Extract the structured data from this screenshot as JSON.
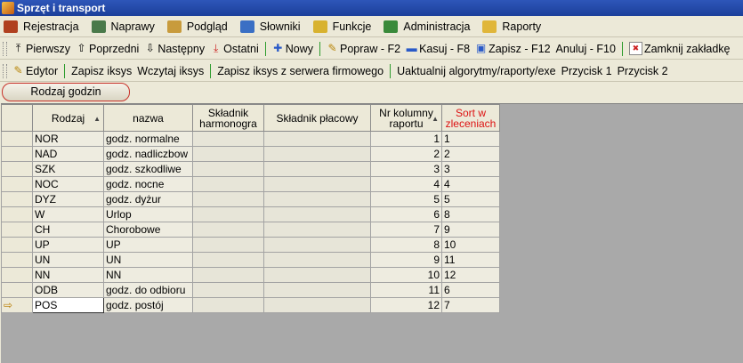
{
  "window": {
    "title": "Sprzęt i transport"
  },
  "menu": [
    {
      "label": "Rejestracja",
      "icon": "pen-icon",
      "color": "#b0401f"
    },
    {
      "label": "Naprawy",
      "icon": "wrench-icon",
      "color": "#4a7a4a"
    },
    {
      "label": "Podgląd",
      "icon": "clipboard-icon",
      "color": "#c89b3c"
    },
    {
      "label": "Słowniki",
      "icon": "book-icon",
      "color": "#3a6fc4"
    },
    {
      "label": "Funkcje",
      "icon": "gear-icon",
      "color": "#d8b22f"
    },
    {
      "label": "Administracja",
      "icon": "books-icon",
      "color": "#3a8a3a"
    },
    {
      "label": "Raporty",
      "icon": "report-icon",
      "color": "#e0b63a"
    }
  ],
  "toolbar1": [
    {
      "label": "Pierwszy",
      "icon": "⤒"
    },
    {
      "label": "Poprzedni",
      "icon": "⇧"
    },
    {
      "label": "Następny",
      "icon": "⇩"
    },
    {
      "label": "Ostatni",
      "icon": "⤓"
    },
    {
      "label": "Nowy",
      "icon": "✚"
    },
    {
      "label": "Popraw - F2",
      "icon": "✎"
    },
    {
      "label": "Kasuj - F8",
      "icon": "▬"
    },
    {
      "label": "Zapisz - F12",
      "icon": "▣"
    },
    {
      "label": "Anuluj - F10",
      "icon": ""
    },
    {
      "label": "Zamknij zakładkę",
      "icon": "✖"
    }
  ],
  "toolbar2": [
    {
      "label": "Edytor",
      "icon": "✎"
    },
    {
      "label": "Zapisz iksys"
    },
    {
      "label": "Wczytaj iksys"
    },
    {
      "label": "Zapisz iksys z serwera firmowego"
    },
    {
      "label": "Uaktualnij algorytmy/raporty/exe"
    },
    {
      "label": "Przycisk 1"
    },
    {
      "label": "Przycisk 2"
    }
  ],
  "tab_button": "Rodzaj godzin",
  "table": {
    "headers": [
      "Rodzaj",
      "nazwa",
      "Składnik harmonogra",
      "Składnik płacowy",
      "Nr kolumny raportu",
      "Sort w zleceniach"
    ],
    "rows": [
      {
        "kod": "NOR",
        "nazwa": "godz. normalne",
        "nr": "1",
        "sort": "1"
      },
      {
        "kod": "NAD",
        "nazwa": "godz. nadliczbow",
        "nr": "2",
        "sort": "2"
      },
      {
        "kod": "SZK",
        "nazwa": "godz. szkodliwe",
        "nr": "3",
        "sort": "3"
      },
      {
        "kod": "NOC",
        "nazwa": "godz. nocne",
        "nr": "4",
        "sort": "4"
      },
      {
        "kod": "DYZ",
        "nazwa": "godz. dyżur",
        "nr": "5",
        "sort": "5"
      },
      {
        "kod": "W",
        "nazwa": "Urlop",
        "nr": "6",
        "sort": "8"
      },
      {
        "kod": "CH",
        "nazwa": "Chorobowe",
        "nr": "7",
        "sort": "9"
      },
      {
        "kod": "UP",
        "nazwa": "UP",
        "nr": "8",
        "sort": "10"
      },
      {
        "kod": "UN",
        "nazwa": "UN",
        "nr": "9",
        "sort": "11"
      },
      {
        "kod": "NN",
        "nazwa": "NN",
        "nr": "10",
        "sort": "12"
      },
      {
        "kod": "ODB",
        "nazwa": "godz. do odbioru",
        "nr": "11",
        "sort": "6"
      },
      {
        "kod": "POS",
        "nazwa": "godz. postój",
        "nr": "12",
        "sort": "7"
      }
    ]
  }
}
